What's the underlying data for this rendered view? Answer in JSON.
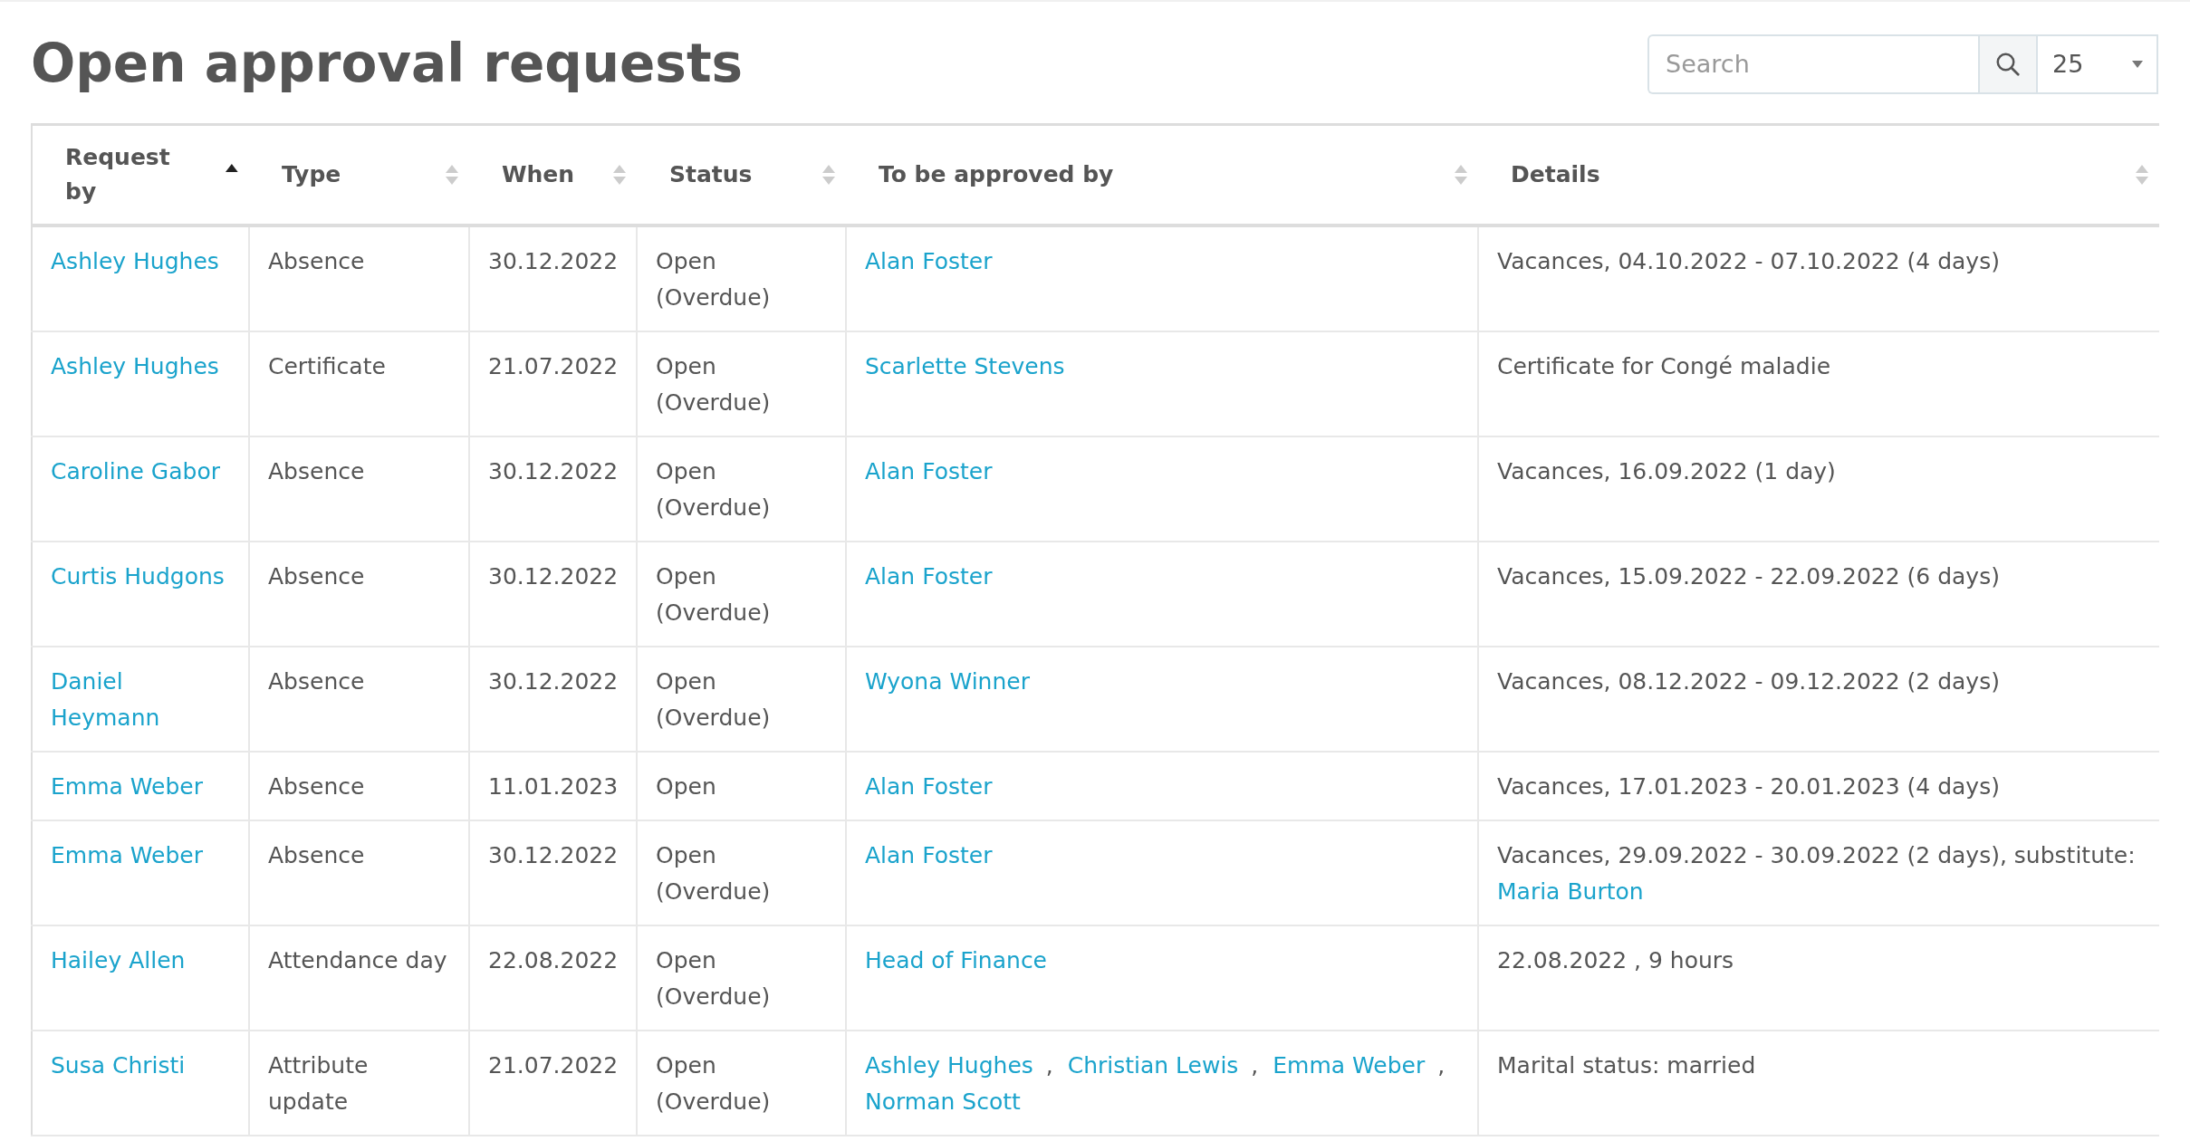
{
  "title": "Open approval requests",
  "search": {
    "placeholder": "Search"
  },
  "page_size": {
    "value": "25"
  },
  "table": {
    "columns": [
      {
        "label": "Request by",
        "sorted": true
      },
      {
        "label": "Type",
        "sorted": false
      },
      {
        "label": "When",
        "sorted": false
      },
      {
        "label": "Status",
        "sorted": false
      },
      {
        "label": "To be approved by",
        "sorted": false
      },
      {
        "label": "Details",
        "sorted": false
      }
    ],
    "rows": [
      {
        "request_by": "Ashley Hughes",
        "type": "Absence",
        "when": "30.12.2022",
        "status": "Open (Overdue)",
        "approved_by": [
          {
            "kind": "link",
            "text": "Alan Foster"
          }
        ],
        "details": [
          {
            "kind": "text",
            "text": "Vacances, 04.10.2022 - 07.10.2022 (4 days)"
          }
        ]
      },
      {
        "request_by": "Ashley Hughes",
        "type": "Certificate",
        "when": "21.07.2022",
        "status": "Open (Overdue)",
        "approved_by": [
          {
            "kind": "link",
            "text": "Scarlette Stevens"
          }
        ],
        "details": [
          {
            "kind": "text",
            "text": "Certificate for Congé maladie"
          }
        ]
      },
      {
        "request_by": "Caroline Gabor",
        "type": "Absence",
        "when": "30.12.2022",
        "status": "Open (Overdue)",
        "approved_by": [
          {
            "kind": "link",
            "text": "Alan Foster"
          }
        ],
        "details": [
          {
            "kind": "text",
            "text": "Vacances, 16.09.2022 (1 day)"
          }
        ]
      },
      {
        "request_by": "Curtis Hudgons",
        "type": "Absence",
        "when": "30.12.2022",
        "status": "Open (Overdue)",
        "approved_by": [
          {
            "kind": "link",
            "text": "Alan Foster"
          }
        ],
        "details": [
          {
            "kind": "text",
            "text": "Vacances, 15.09.2022 - 22.09.2022 (6 days)"
          }
        ]
      },
      {
        "request_by": "Daniel Heymann",
        "type": "Absence",
        "when": "30.12.2022",
        "status": "Open (Overdue)",
        "approved_by": [
          {
            "kind": "link",
            "text": "Wyona Winner"
          }
        ],
        "details": [
          {
            "kind": "text",
            "text": "Vacances, 08.12.2022 - 09.12.2022 (2 days)"
          }
        ]
      },
      {
        "request_by": "Emma Weber",
        "type": "Absence",
        "when": "11.01.2023",
        "status": "Open",
        "approved_by": [
          {
            "kind": "link",
            "text": "Alan Foster"
          }
        ],
        "details": [
          {
            "kind": "text",
            "text": "Vacances, 17.01.2023 - 20.01.2023 (4 days)"
          }
        ]
      },
      {
        "request_by": "Emma Weber",
        "type": "Absence",
        "when": "30.12.2022",
        "status": "Open (Overdue)",
        "approved_by": [
          {
            "kind": "link",
            "text": "Alan Foster"
          }
        ],
        "details": [
          {
            "kind": "text",
            "text": "Vacances, 29.09.2022 - 30.09.2022 (2 days), substitute:"
          },
          {
            "kind": "link",
            "text": "Maria Burton"
          }
        ]
      },
      {
        "request_by": "Hailey Allen",
        "type": "Attendance day",
        "when": "22.08.2022",
        "status": "Open (Overdue)",
        "approved_by": [
          {
            "kind": "link",
            "text": "Head of Finance"
          }
        ],
        "details": [
          {
            "kind": "text",
            "text": "22.08.2022 , 9 hours"
          }
        ]
      },
      {
        "request_by": "Susa Christi",
        "type": "Attribute update",
        "when": "21.07.2022",
        "status": "Open (Overdue)",
        "approved_by": [
          {
            "kind": "link",
            "text": "Ashley Hughes"
          },
          {
            "kind": "text",
            "text": ","
          },
          {
            "kind": "link",
            "text": "Christian Lewis"
          },
          {
            "kind": "text",
            "text": ","
          },
          {
            "kind": "link",
            "text": "Emma Weber"
          },
          {
            "kind": "text",
            "text": ","
          },
          {
            "kind": "link",
            "text": "Norman Scott"
          }
        ],
        "details": [
          {
            "kind": "text",
            "text": "Marital status: married"
          }
        ]
      }
    ]
  }
}
